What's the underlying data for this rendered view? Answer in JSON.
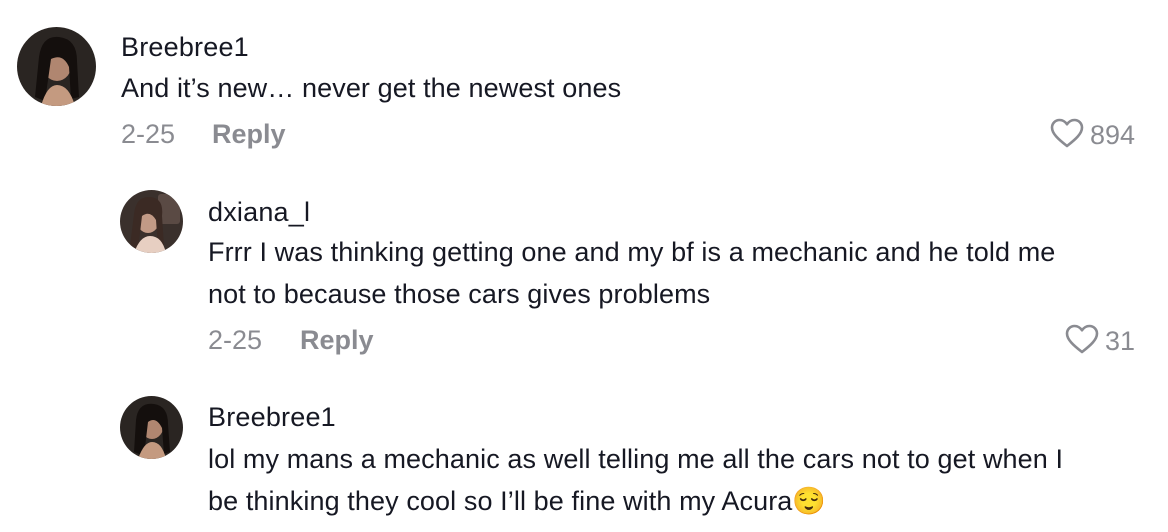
{
  "comments": [
    {
      "username": "Breebree1",
      "text": "And it’s new… never get the newest ones",
      "date": "2-25",
      "reply_label": "Reply",
      "likes": "894",
      "avatar_icon": "profile-photo"
    },
    {
      "username": "dxiana_l",
      "text_line1": "Frrr I was thinking getting one and my bf is a mechanic and he told me",
      "text_line2": "not to because those cars gives problems",
      "date": "2-25",
      "reply_label": "Reply",
      "likes": "31",
      "avatar_icon": "profile-photo"
    },
    {
      "username": "Breebree1",
      "text_line1": "lol my mans a mechanic as well telling me all the cars not to get when I",
      "text_line2": "be thinking they cool so I’ll be fine with my Acura",
      "emoji": "😌",
      "avatar_icon": "profile-photo"
    }
  ],
  "icons": {
    "like": "heart-outline-icon"
  },
  "colors": {
    "text_primary": "#161823",
    "text_secondary": "#8a8b91"
  }
}
